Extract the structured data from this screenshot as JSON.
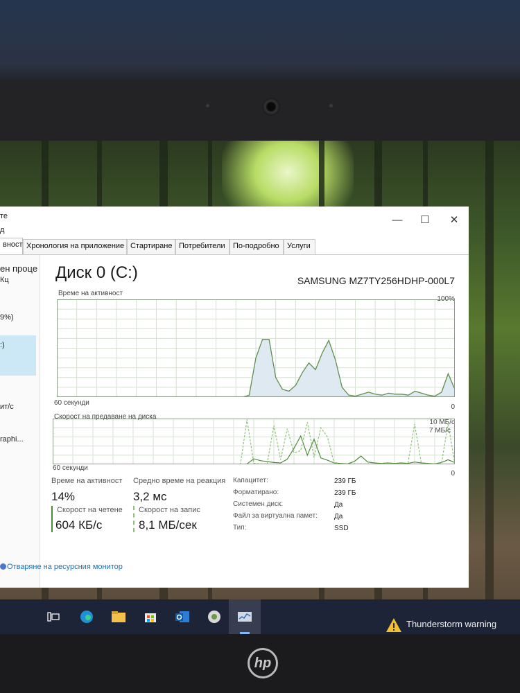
{
  "window": {
    "title_fragment": "те",
    "menu_fragment": "д",
    "controls": {
      "minimize": "—",
      "maximize": "☐",
      "close": "✕"
    }
  },
  "tabs": [
    {
      "label": "вност",
      "active": true
    },
    {
      "label": "Хронология на приложение"
    },
    {
      "label": "Стартиране"
    },
    {
      "label": "Потребители"
    },
    {
      "label": "По-подробно"
    },
    {
      "label": "Услуги"
    }
  ],
  "sidebar": {
    "items": [
      "ен проце",
      "Кц",
      "9%)",
      ":)",
      "ит/с",
      "raphi..."
    ]
  },
  "disk": {
    "title": "Диск 0 (C:)",
    "model": "SAMSUNG MZ7TY256HDHP-000L7"
  },
  "chart_data": [
    {
      "type": "area",
      "title": "Време на активност",
      "xlabel": "60 секунди",
      "ymax_label": "100%",
      "ymin_label": "0",
      "ylim": [
        0,
        100
      ],
      "x": [
        0,
        1,
        2,
        3,
        4,
        5,
        6,
        7,
        8,
        9,
        10,
        11,
        12,
        13,
        14,
        15,
        16,
        17,
        18,
        19,
        20,
        21,
        22,
        23,
        24,
        25,
        26,
        27,
        28,
        29,
        30,
        31,
        32,
        33,
        34,
        35,
        36,
        37,
        38,
        39,
        40,
        41,
        42,
        43,
        44,
        45,
        46,
        47,
        48,
        49,
        50,
        51,
        52,
        53,
        54,
        55,
        56,
        57,
        58,
        59,
        60
      ],
      "series": [
        {
          "values": [
            0,
            0,
            0,
            0,
            0,
            0,
            0,
            0,
            0,
            0,
            0,
            0,
            0,
            0,
            0,
            0,
            0,
            0,
            0,
            0,
            0,
            0,
            0,
            0,
            0,
            0,
            0,
            0,
            0,
            2,
            40,
            59,
            59,
            20,
            8,
            6,
            12,
            25,
            35,
            28,
            45,
            58,
            38,
            10,
            2,
            1,
            3,
            5,
            3,
            2,
            4,
            3,
            3,
            2,
            6,
            4,
            2,
            1,
            5,
            24,
            8
          ]
        }
      ]
    },
    {
      "type": "line",
      "title": "Скорост на предаване на диска",
      "xlabel": "60 секунди",
      "ymax_label": "10 МБ/с",
      "secondary_label": "7 МБ/с",
      "ymin_label": "0",
      "ylim": [
        0,
        10
      ],
      "x": [
        0,
        1,
        2,
        3,
        4,
        5,
        6,
        7,
        8,
        9,
        10,
        11,
        12,
        13,
        14,
        15,
        16,
        17,
        18,
        19,
        20,
        21,
        22,
        23,
        24,
        25,
        26,
        27,
        28,
        29,
        30,
        31,
        32,
        33,
        34,
        35,
        36,
        37,
        38,
        39,
        40,
        41,
        42,
        43,
        44,
        45,
        46,
        47,
        48,
        49,
        50,
        51,
        52,
        53,
        54,
        55,
        56,
        57,
        58,
        59,
        60
      ],
      "series": [
        {
          "color": "#4f8a3a",
          "values": [
            0,
            0,
            0,
            0,
            0,
            0,
            0,
            0,
            0,
            0,
            0,
            0,
            0,
            0,
            0,
            0,
            0,
            0,
            0,
            0,
            0,
            0,
            0,
            0,
            0,
            0,
            0,
            0,
            0,
            0.1,
            1.2,
            0.8,
            0.6,
            0.4,
            0.3,
            1.1,
            3.5,
            6.2,
            2.0,
            5.5,
            1.4,
            0.9,
            0.3,
            0.2,
            0.1,
            0.6,
            1.8,
            0.5,
            0.3,
            0.2,
            0.3,
            0.2,
            0.3,
            0.2,
            0.5,
            0.3,
            0.2,
            0.1,
            0.4,
            1.0,
            0.4
          ]
        },
        {
          "color": "#8ec27a",
          "dashed": true,
          "values": [
            0,
            0,
            0,
            0,
            0,
            0,
            0,
            0,
            0,
            0,
            0,
            0,
            0,
            0,
            0,
            0,
            0,
            0,
            0,
            0,
            0,
            0,
            0,
            0,
            0,
            0,
            0,
            0,
            0,
            9.8,
            0.2,
            0.1,
            0.1,
            8.5,
            1.0,
            7.8,
            2.5,
            3.0,
            9.2,
            1.5,
            8.0,
            6.0,
            0.2,
            0.1,
            0.1,
            0.1,
            0.1,
            0.1,
            0.1,
            0.1,
            0.2,
            0.1,
            0.1,
            0.1,
            8.8,
            0.2,
            0.1,
            0.1,
            0.1,
            9.0,
            0.1
          ]
        }
      ]
    }
  ],
  "stats": {
    "activity_label": "Време на активност",
    "activity_value": "14%",
    "response_label": "Средно време на реакция",
    "response_value": "3,2 мс",
    "read_label": "Скорост на четене",
    "read_value": "604 КБ/с",
    "write_label": "Скорост на запис",
    "write_value": "8,1 МБ/сек",
    "read_color": "#4f8a3a",
    "write_color": "#8ec27a",
    "props": [
      {
        "key": "Капацитет:",
        "value": "239 ГБ"
      },
      {
        "key": "Форматирано:",
        "value": "239 ГБ"
      },
      {
        "key": "Системен диск:",
        "value": "Да"
      },
      {
        "key": "Файл за виртуална памет:",
        "value": "Да"
      },
      {
        "key": "Тип:",
        "value": "SSD"
      }
    ]
  },
  "resmon_link": "Отваряне на ресурсния монитор",
  "taskbar": {
    "icons": [
      "task-view-icon",
      "edge-icon",
      "file-explorer-icon",
      "store-icon",
      "outlook-icon",
      "app-icon",
      "task-manager-icon"
    ],
    "weather_text": "Thunderstorm warning"
  },
  "brand": "hp"
}
